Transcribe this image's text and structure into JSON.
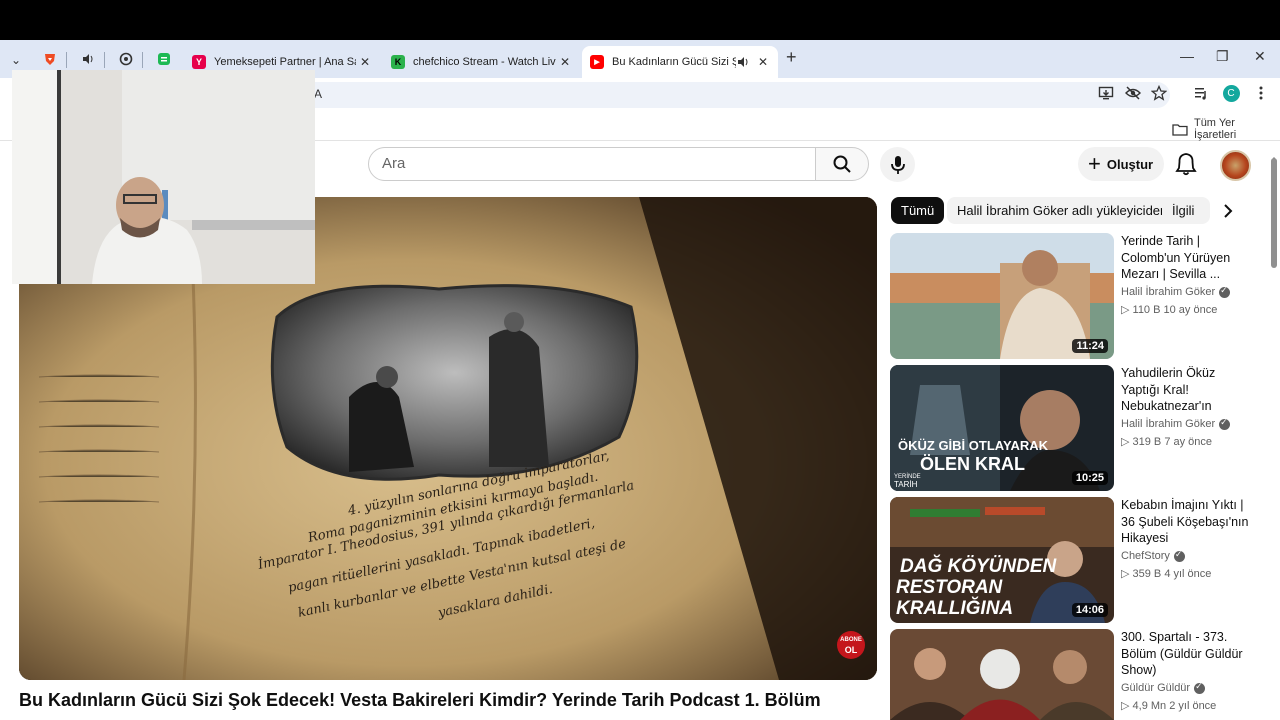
{
  "browser": {
    "tabs": [
      {
        "title": "Yemeksepeti Partner | Ana Sayfa",
        "close": "✕",
        "favicon_color": "#e6004c",
        "favicon_letter": "Y"
      },
      {
        "title": "chefchico Stream - Watch Live o",
        "close": "✕",
        "favicon_color": "#2bb24c",
        "favicon_letter": "K"
      },
      {
        "title": "Bu Kadınların Gücü Sizi Şok",
        "close": "✕",
        "favicon_color": "#ff0000",
        "favicon_letter": "▶"
      }
    ],
    "tab_dropdown": "⌄",
    "new_tab": "+",
    "window_controls": {
      "minimize": "—",
      "maximize": "❐",
      "close": "✕"
    },
    "url_fragment": "A",
    "bookmarks_all": "Tüm Yer İşaretleri",
    "profile_letter": "C"
  },
  "youtube": {
    "search_placeholder": "Ara",
    "create_label": "Oluştur",
    "video_title": "Bu Kadınların Gücü Sizi Şok Edecek! Vesta Bakireleri Kimdir? Yerinde Tarih Podcast 1. Bölüm",
    "chips": [
      "Tümü",
      "Halil İbrahim Göker adlı yükleyiciden",
      "İlgili"
    ],
    "recommendations": [
      {
        "title": "Yerinde Tarih | Colomb'un Yürüyen Mezarı | Sevilla ...",
        "channel": "Halil İbrahim Göker",
        "views": "▷ 110 B",
        "age": "10 ay önce",
        "duration": "11:24"
      },
      {
        "title": "Yahudilerin Öküz Yaptığı Kral! Nebukatnezar'ın Hayatı! Yerinde Tarih ...",
        "channel": "Halil İbrahim Göker",
        "views": "▷ 319 B",
        "age": "7 ay önce",
        "duration": "10:25"
      },
      {
        "title": "Kebabın İmajını Yıktı | 36 Şubeli Köşebaşı'nın Hikayesi",
        "channel": "ChefStory",
        "views": "▷ 359 B",
        "age": "4 yıl önce",
        "duration": "14:06"
      },
      {
        "title": "300. Spartalı - 373. Bölüm (Güldür Güldür Show)",
        "channel": "Güldür Güldür",
        "views": "▷ 4,9 Mn",
        "age": "2 yıl önce",
        "duration": ""
      }
    ],
    "thumb_captions": {
      "t2_line1": "ÖKÜZ GİBİ OTLAYARAK",
      "t2_line2": "ÖLEN KRAL",
      "t2_logo_1": "YERİNDE",
      "t2_logo_2": "TARİH",
      "t3_line1": "DAĞ KÖYÜNDEN",
      "t3_line2": "RESTORAN",
      "t3_line3": "KRALLIĞINA"
    },
    "handwriting": [
      "4. yüzyılın sonlarına doğru imparatorlar,",
      "Roma paganizminin etkisini kırmaya başladı.",
      "İmparator I. Theodosius, 391 yılında çıkardığı fermanlarla",
      "pagan ritüellerini yasakladı. Tapınak ibadetleri,",
      "kanlı kurbanlar ve elbette Vesta'nın kutsal ateşi de",
      "yasaklara dahildi."
    ],
    "subscribe_badge_1": "ABONE",
    "subscribe_badge_2": "OL"
  },
  "colors": {
    "accent_red": "#ff0000",
    "chip_active": "#0f0f0f",
    "chip_bg": "#f2f2f2"
  }
}
